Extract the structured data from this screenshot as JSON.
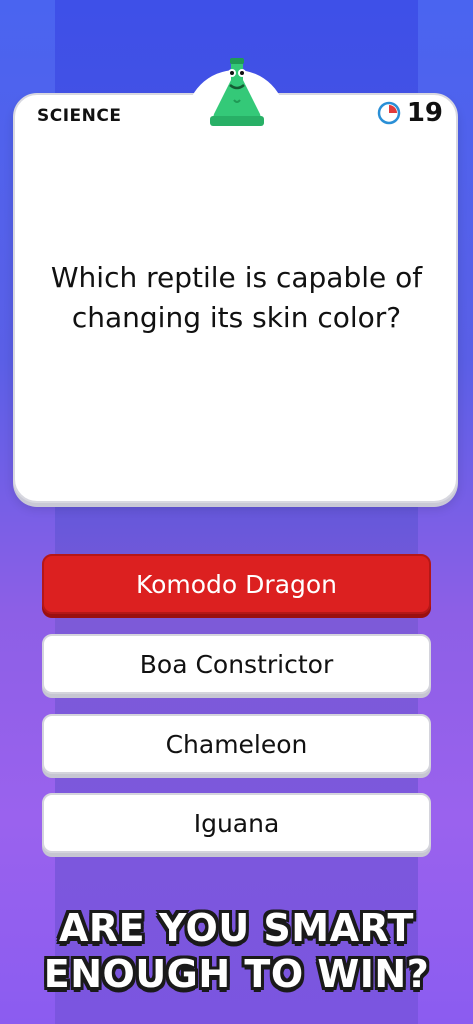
{
  "category": "SCIENCE",
  "timer": {
    "value": "19",
    "elapsed_fraction": 0.25,
    "icon": "pie-timer-icon"
  },
  "mascot": {
    "icon": "flask-mascot-icon",
    "color": "#2fbf71"
  },
  "question": "Which reptile is capable of changing its skin color?",
  "answers": [
    {
      "label": "Komodo Dragon",
      "state": "wrong"
    },
    {
      "label": "Boa Constrictor",
      "state": "default"
    },
    {
      "label": "Chameleon",
      "state": "default"
    },
    {
      "label": "Iguana",
      "state": "default"
    }
  ],
  "promo": {
    "line1": "ARE YOU SMART",
    "line2": "ENOUGH TO WIN?"
  },
  "colors": {
    "wrong_answer": "#dc2020",
    "timer_accent": "#e23b3b",
    "timer_ring": "#2a8fd6"
  }
}
